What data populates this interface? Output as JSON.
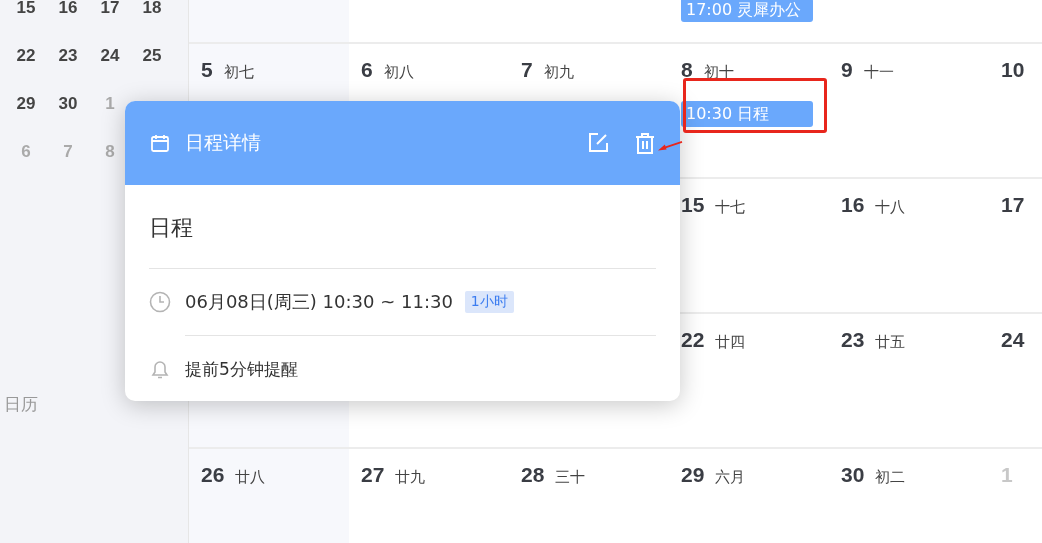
{
  "mini_calendar": {
    "rows": [
      [
        {
          "day": "15",
          "muted": false
        },
        {
          "day": "16",
          "muted": false
        },
        {
          "day": "17",
          "muted": false
        },
        {
          "day": "18",
          "muted": false
        }
      ],
      [
        {
          "day": "22",
          "muted": false
        },
        {
          "day": "23",
          "muted": false
        },
        {
          "day": "24",
          "muted": false
        },
        {
          "day": "25",
          "muted": false
        }
      ],
      [
        {
          "day": "29",
          "muted": false
        },
        {
          "day": "30",
          "muted": false
        },
        {
          "day": "1",
          "muted": true
        }
      ],
      [
        {
          "day": "6",
          "muted": true
        },
        {
          "day": "7",
          "muted": true
        },
        {
          "day": "8",
          "muted": true
        }
      ]
    ]
  },
  "sidebar": {
    "items": [
      {
        "label": "日历"
      }
    ]
  },
  "calendar": {
    "weeks": [
      {
        "kind": "partial",
        "cells": [
          {},
          {},
          {},
          {
            "events": [
              {
                "label": "17:00 灵犀办公"
              }
            ]
          },
          {},
          {}
        ]
      },
      {
        "kind": "full",
        "cells": [
          {
            "day": "5",
            "lunar": "初七",
            "muted": false
          },
          {
            "day": "6",
            "lunar": "初八",
            "muted": false
          },
          {
            "day": "7",
            "lunar": "初九",
            "muted": false
          },
          {
            "day": "8",
            "lunar": "初十",
            "muted": false,
            "events": [
              {
                "label": "10:30 日程"
              }
            ]
          },
          {
            "day": "9",
            "lunar": "十一",
            "muted": false
          },
          {
            "day": "10",
            "muted": false
          }
        ]
      },
      {
        "kind": "full",
        "cells": [
          {},
          {},
          {},
          {
            "day": "15",
            "lunar": "十七",
            "muted": false
          },
          {
            "day": "16",
            "lunar": "十八",
            "muted": false
          },
          {
            "day": "17",
            "muted": false
          }
        ]
      },
      {
        "kind": "full",
        "cells": [
          {},
          {},
          {},
          {
            "day": "22",
            "lunar": "廿四",
            "muted": false
          },
          {
            "day": "23",
            "lunar": "廿五",
            "muted": false
          },
          {
            "day": "24",
            "muted": false
          }
        ]
      },
      {
        "kind": "full",
        "cells": [
          {
            "day": "26",
            "lunar": "廿八",
            "muted": false
          },
          {
            "day": "27",
            "lunar": "廿九",
            "muted": false
          },
          {
            "day": "28",
            "lunar": "三十",
            "muted": false
          },
          {
            "day": "29",
            "lunar": "六月",
            "muted": false
          },
          {
            "day": "30",
            "lunar": "初二",
            "muted": false
          },
          {
            "day": "1",
            "muted": true
          }
        ]
      }
    ]
  },
  "popup": {
    "title": "日程详情",
    "event_title": "日程",
    "time": "06月08日(周三) 10:30 ~ 11:30",
    "duration": "1小时",
    "reminder": "提前5分钟提醒"
  },
  "annotations": {
    "highlight_box": true,
    "arrow": true
  }
}
